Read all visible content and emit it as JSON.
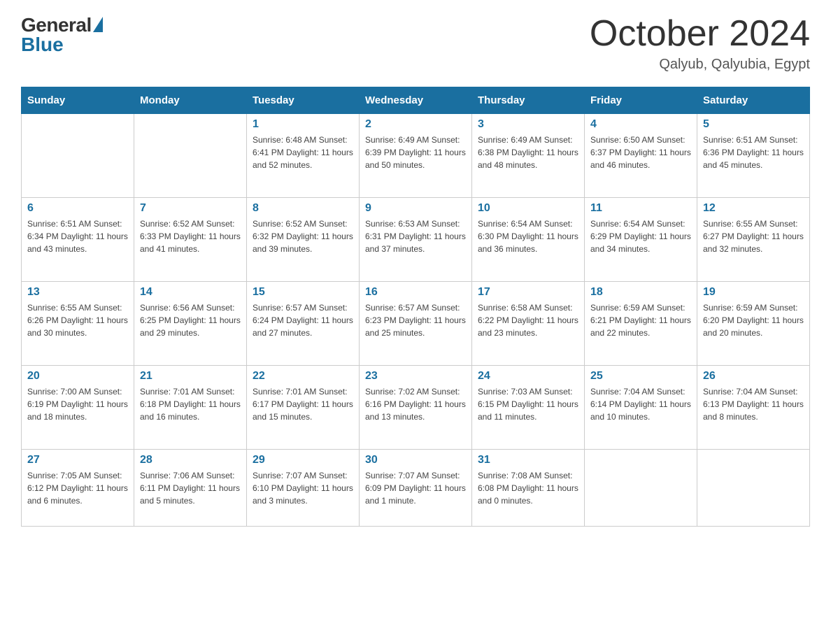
{
  "header": {
    "logo": {
      "general_text": "General",
      "blue_text": "Blue"
    },
    "title": "October 2024",
    "location": "Qalyub, Qalyubia, Egypt"
  },
  "calendar": {
    "days_of_week": [
      "Sunday",
      "Monday",
      "Tuesday",
      "Wednesday",
      "Thursday",
      "Friday",
      "Saturday"
    ],
    "weeks": [
      [
        {
          "day": "",
          "info": ""
        },
        {
          "day": "",
          "info": ""
        },
        {
          "day": "1",
          "info": "Sunrise: 6:48 AM\nSunset: 6:41 PM\nDaylight: 11 hours\nand 52 minutes."
        },
        {
          "day": "2",
          "info": "Sunrise: 6:49 AM\nSunset: 6:39 PM\nDaylight: 11 hours\nand 50 minutes."
        },
        {
          "day": "3",
          "info": "Sunrise: 6:49 AM\nSunset: 6:38 PM\nDaylight: 11 hours\nand 48 minutes."
        },
        {
          "day": "4",
          "info": "Sunrise: 6:50 AM\nSunset: 6:37 PM\nDaylight: 11 hours\nand 46 minutes."
        },
        {
          "day": "5",
          "info": "Sunrise: 6:51 AM\nSunset: 6:36 PM\nDaylight: 11 hours\nand 45 minutes."
        }
      ],
      [
        {
          "day": "6",
          "info": "Sunrise: 6:51 AM\nSunset: 6:34 PM\nDaylight: 11 hours\nand 43 minutes."
        },
        {
          "day": "7",
          "info": "Sunrise: 6:52 AM\nSunset: 6:33 PM\nDaylight: 11 hours\nand 41 minutes."
        },
        {
          "day": "8",
          "info": "Sunrise: 6:52 AM\nSunset: 6:32 PM\nDaylight: 11 hours\nand 39 minutes."
        },
        {
          "day": "9",
          "info": "Sunrise: 6:53 AM\nSunset: 6:31 PM\nDaylight: 11 hours\nand 37 minutes."
        },
        {
          "day": "10",
          "info": "Sunrise: 6:54 AM\nSunset: 6:30 PM\nDaylight: 11 hours\nand 36 minutes."
        },
        {
          "day": "11",
          "info": "Sunrise: 6:54 AM\nSunset: 6:29 PM\nDaylight: 11 hours\nand 34 minutes."
        },
        {
          "day": "12",
          "info": "Sunrise: 6:55 AM\nSunset: 6:27 PM\nDaylight: 11 hours\nand 32 minutes."
        }
      ],
      [
        {
          "day": "13",
          "info": "Sunrise: 6:55 AM\nSunset: 6:26 PM\nDaylight: 11 hours\nand 30 minutes."
        },
        {
          "day": "14",
          "info": "Sunrise: 6:56 AM\nSunset: 6:25 PM\nDaylight: 11 hours\nand 29 minutes."
        },
        {
          "day": "15",
          "info": "Sunrise: 6:57 AM\nSunset: 6:24 PM\nDaylight: 11 hours\nand 27 minutes."
        },
        {
          "day": "16",
          "info": "Sunrise: 6:57 AM\nSunset: 6:23 PM\nDaylight: 11 hours\nand 25 minutes."
        },
        {
          "day": "17",
          "info": "Sunrise: 6:58 AM\nSunset: 6:22 PM\nDaylight: 11 hours\nand 23 minutes."
        },
        {
          "day": "18",
          "info": "Sunrise: 6:59 AM\nSunset: 6:21 PM\nDaylight: 11 hours\nand 22 minutes."
        },
        {
          "day": "19",
          "info": "Sunrise: 6:59 AM\nSunset: 6:20 PM\nDaylight: 11 hours\nand 20 minutes."
        }
      ],
      [
        {
          "day": "20",
          "info": "Sunrise: 7:00 AM\nSunset: 6:19 PM\nDaylight: 11 hours\nand 18 minutes."
        },
        {
          "day": "21",
          "info": "Sunrise: 7:01 AM\nSunset: 6:18 PM\nDaylight: 11 hours\nand 16 minutes."
        },
        {
          "day": "22",
          "info": "Sunrise: 7:01 AM\nSunset: 6:17 PM\nDaylight: 11 hours\nand 15 minutes."
        },
        {
          "day": "23",
          "info": "Sunrise: 7:02 AM\nSunset: 6:16 PM\nDaylight: 11 hours\nand 13 minutes."
        },
        {
          "day": "24",
          "info": "Sunrise: 7:03 AM\nSunset: 6:15 PM\nDaylight: 11 hours\nand 11 minutes."
        },
        {
          "day": "25",
          "info": "Sunrise: 7:04 AM\nSunset: 6:14 PM\nDaylight: 11 hours\nand 10 minutes."
        },
        {
          "day": "26",
          "info": "Sunrise: 7:04 AM\nSunset: 6:13 PM\nDaylight: 11 hours\nand 8 minutes."
        }
      ],
      [
        {
          "day": "27",
          "info": "Sunrise: 7:05 AM\nSunset: 6:12 PM\nDaylight: 11 hours\nand 6 minutes."
        },
        {
          "day": "28",
          "info": "Sunrise: 7:06 AM\nSunset: 6:11 PM\nDaylight: 11 hours\nand 5 minutes."
        },
        {
          "day": "29",
          "info": "Sunrise: 7:07 AM\nSunset: 6:10 PM\nDaylight: 11 hours\nand 3 minutes."
        },
        {
          "day": "30",
          "info": "Sunrise: 7:07 AM\nSunset: 6:09 PM\nDaylight: 11 hours\nand 1 minute."
        },
        {
          "day": "31",
          "info": "Sunrise: 7:08 AM\nSunset: 6:08 PM\nDaylight: 11 hours\nand 0 minutes."
        },
        {
          "day": "",
          "info": ""
        },
        {
          "day": "",
          "info": ""
        }
      ]
    ]
  },
  "colors": {
    "header_bg": "#1a6fa0",
    "accent": "#1a6fa0",
    "day_number": "#1a6fa0"
  }
}
